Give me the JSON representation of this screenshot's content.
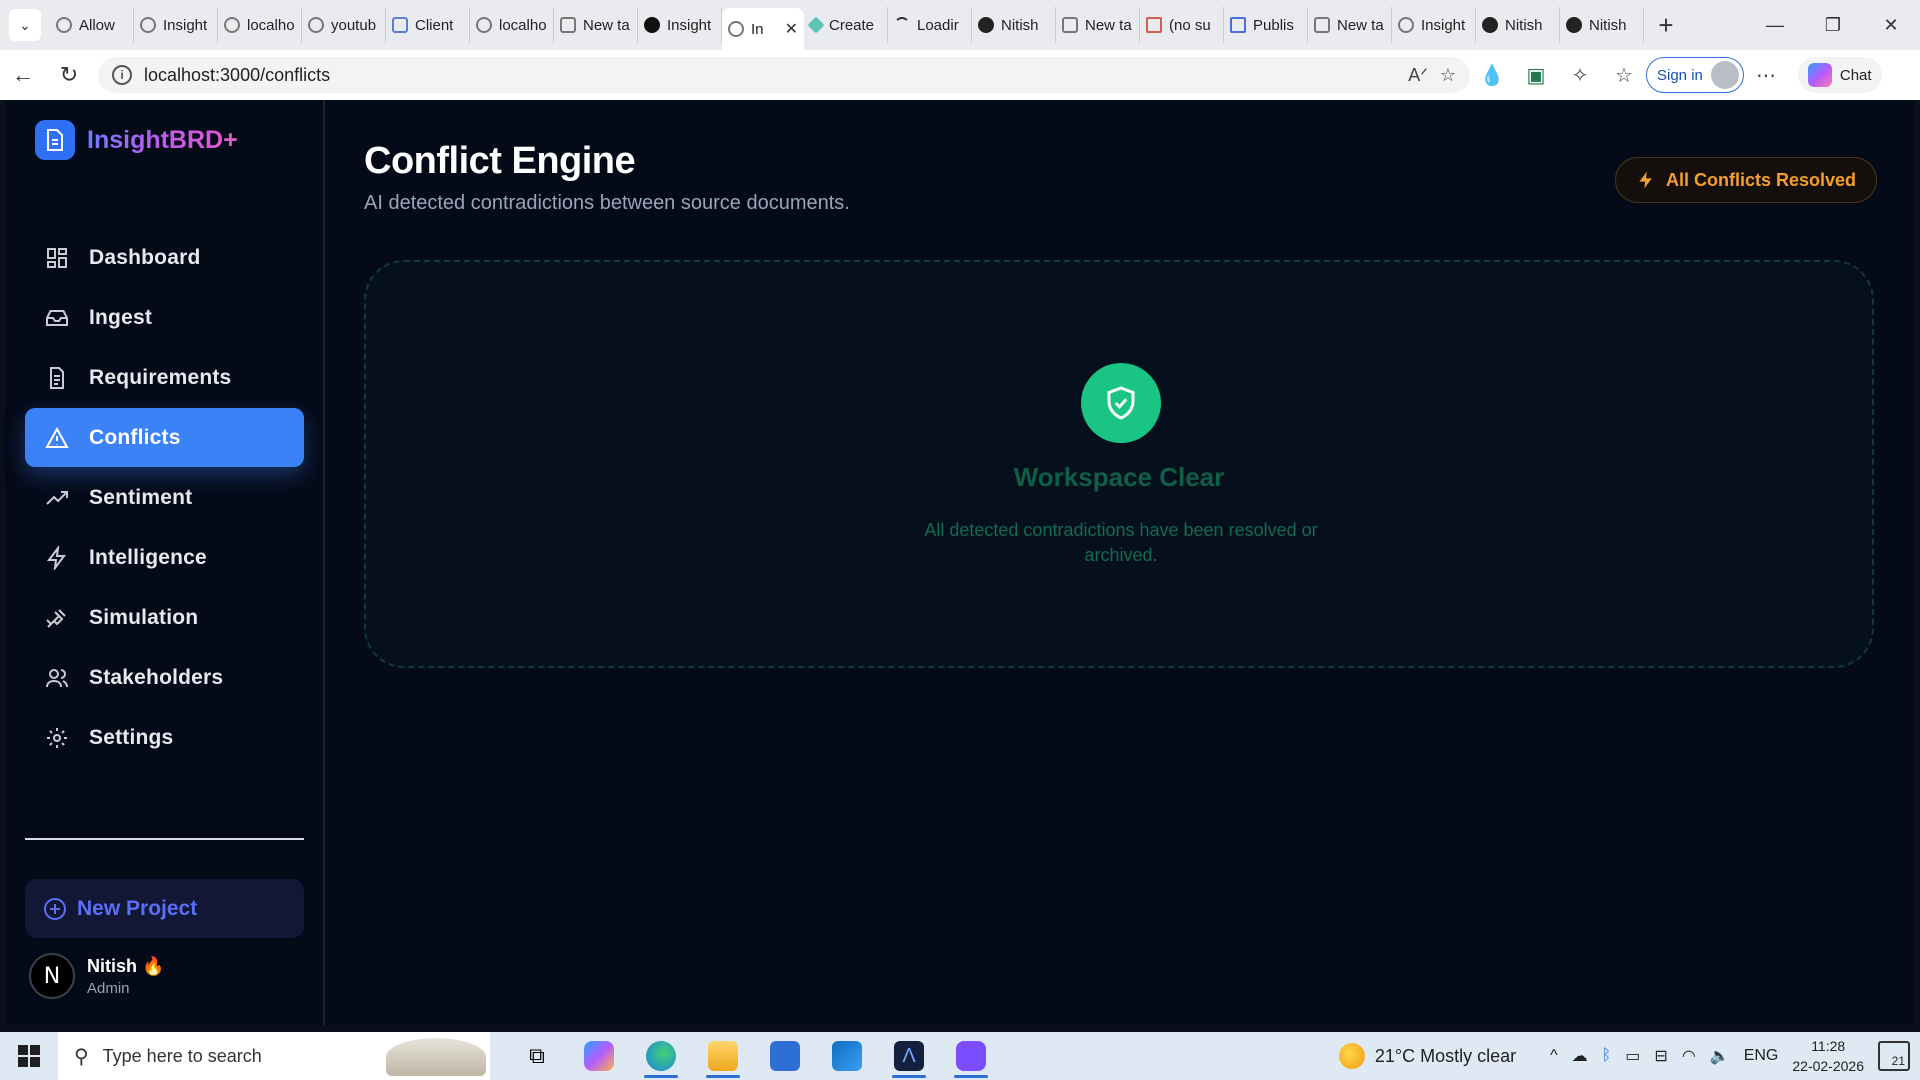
{
  "browser": {
    "tabs": [
      {
        "label": "Allow"
      },
      {
        "label": "Insight"
      },
      {
        "label": "localho"
      },
      {
        "label": "youtub"
      },
      {
        "label": "Client"
      },
      {
        "label": "localho"
      },
      {
        "label": "New ta"
      },
      {
        "label": "Insight"
      },
      {
        "label": "In",
        "active": true
      },
      {
        "label": "Create"
      },
      {
        "label": "Loadir"
      },
      {
        "label": "Nitish"
      },
      {
        "label": "New ta"
      },
      {
        "label": "(no su"
      },
      {
        "label": "Publis"
      },
      {
        "label": "New ta"
      },
      {
        "label": "Insight"
      },
      {
        "label": "Nitish"
      },
      {
        "label": "Nitish"
      }
    ],
    "url": "localhost:3000/conflicts",
    "sign_in_label": "Sign in",
    "chat_label": "Chat"
  },
  "sidebar": {
    "brand": "InsightBRD+",
    "items": [
      {
        "label": "Dashboard",
        "icon": "grid-icon"
      },
      {
        "label": "Ingest",
        "icon": "inbox-icon"
      },
      {
        "label": "Requirements",
        "icon": "document-icon"
      },
      {
        "label": "Conflicts",
        "icon": "warning-triangle-icon",
        "active": true
      },
      {
        "label": "Sentiment",
        "icon": "trending-up-icon"
      },
      {
        "label": "Intelligence",
        "icon": "lightning-icon"
      },
      {
        "label": "Simulation",
        "icon": "simulation-icon"
      },
      {
        "label": "Stakeholders",
        "icon": "users-icon"
      },
      {
        "label": "Settings",
        "icon": "gear-icon"
      }
    ],
    "new_project_label": "New Project",
    "user": {
      "initial": "N",
      "name": "Nitish 🔥",
      "role": "Admin"
    }
  },
  "main": {
    "title": "Conflict Engine",
    "subtitle": "AI detected contradictions between source documents.",
    "status_button": "All Conflicts Resolved",
    "empty_state": {
      "title": "Workspace Clear",
      "text": "All detected contradictions have been resolved or archived."
    }
  },
  "taskbar": {
    "search_placeholder": "Type here to search",
    "weather": "21°C  Mostly clear",
    "language": "ENG",
    "time": "11:28",
    "date": "22-02-2026",
    "notifications": "21"
  },
  "colors": {
    "accent": "#3b82f6",
    "success": "#19c484",
    "warning": "#f59e2b",
    "background": "#050a18"
  }
}
